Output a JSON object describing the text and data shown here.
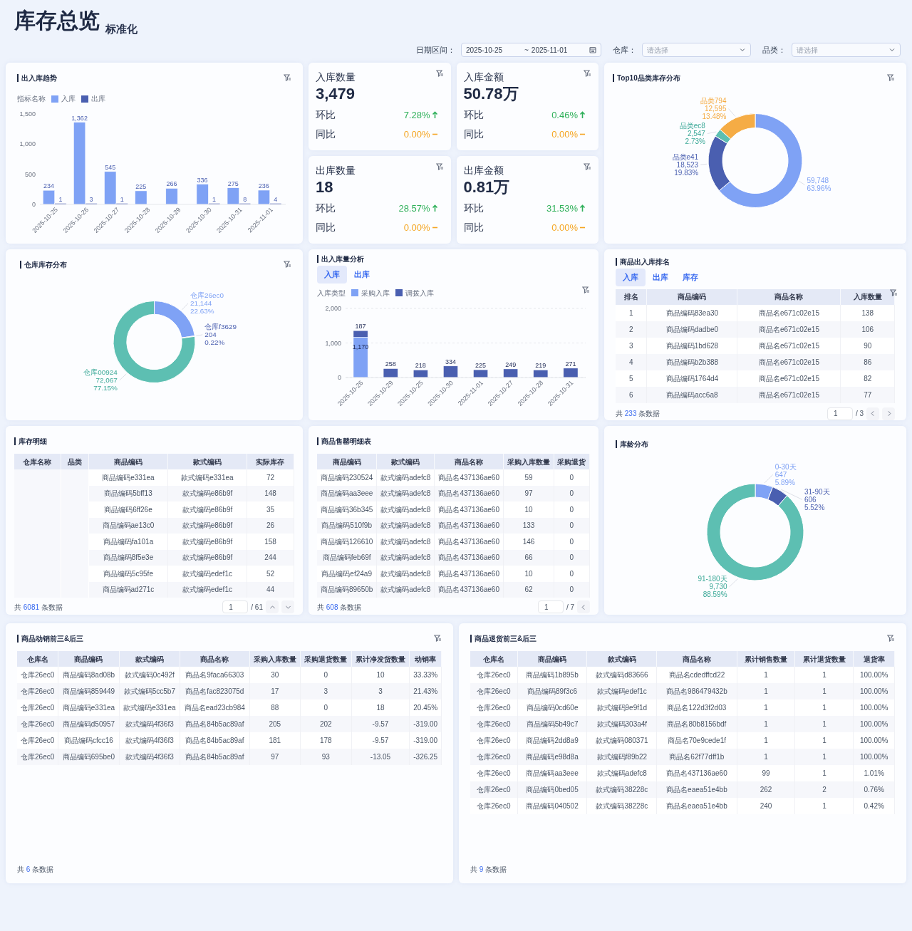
{
  "header": {
    "title": "库存总览",
    "subtitle": "标准化"
  },
  "filters": {
    "date": {
      "label": "日期区间：",
      "start": "2025-10-25",
      "separator": "~",
      "end": "2025-11-01"
    },
    "warehouse": {
      "label": "仓库：",
      "placeholder": "请选择"
    },
    "category": {
      "label": "品类：",
      "placeholder": "请选择"
    }
  },
  "trend": {
    "title": "出入库趋势",
    "legend_title": "指标名称",
    "chart_data": {
      "type": "bar",
      "categories": [
        "2025-10-25",
        "2025-10-26",
        "2025-10-27",
        "2025-10-28",
        "2025-10-29",
        "2025-10-30",
        "2025-10-31",
        "2025-11-01"
      ],
      "series": [
        {
          "name": "入库",
          "color": "#7fa2f5",
          "values": [
            234,
            1362,
            545,
            225,
            266,
            336,
            275,
            236
          ],
          "value_labels": [
            "234",
            "1,362",
            "545",
            "225",
            "266",
            "336",
            "275",
            "236"
          ]
        },
        {
          "name": "出库",
          "color": "#4a5fb0",
          "values": [
            1,
            3,
            1,
            null,
            null,
            1,
            8,
            4
          ],
          "value_labels": [
            "1",
            "3",
            "1",
            null,
            null,
            "1",
            "8",
            "4"
          ]
        }
      ],
      "ylim": [
        0,
        1500
      ],
      "yticks": [
        {
          "value": 0,
          "label": "0"
        },
        {
          "value": 500,
          "label": "500"
        },
        {
          "value": 1000,
          "label": "1,000"
        },
        {
          "value": 1500,
          "label": "1,500"
        }
      ],
      "stacked": false,
      "data_labels": true
    }
  },
  "kpis": [
    {
      "title": "入库数量",
      "value": "3,479",
      "rows": [
        {
          "label": "环比",
          "change": "7.28%",
          "kind": "up"
        },
        {
          "label": "同比",
          "change": "0.00%",
          "kind": "flat"
        }
      ]
    },
    {
      "title": "入库金额",
      "value": "50.78万",
      "rows": [
        {
          "label": "环比",
          "change": "0.46%",
          "kind": "up"
        },
        {
          "label": "同比",
          "change": "0.00%",
          "kind": "flat"
        }
      ]
    },
    {
      "title": "出库数量",
      "value": "18",
      "rows": [
        {
          "label": "环比",
          "change": "28.57%",
          "kind": "up"
        },
        {
          "label": "同比",
          "change": "0.00%",
          "kind": "flat"
        }
      ]
    },
    {
      "title": "出库金额",
      "value": "0.81万",
      "rows": [
        {
          "label": "环比",
          "change": "31.53%",
          "kind": "up"
        },
        {
          "label": "同比",
          "change": "0.00%",
          "kind": "flat"
        }
      ]
    }
  ],
  "top10": {
    "title": "Top10品类库存分布",
    "chart_data": {
      "type": "donut",
      "categories": [
        null,
        "品类e41",
        "品类ec8",
        "品类794"
      ],
      "values": [
        59748,
        18523,
        2547,
        12595
      ],
      "colors": [
        "#7fa2f5",
        "#4a5fb0",
        "#5dbfb2",
        "#f5ac45"
      ],
      "value_labels": [
        "59,748",
        "18,523",
        "2,547",
        "12,595"
      ],
      "annotations": [
        "63.96%",
        "19.83%",
        "2.73%",
        "13.48%"
      ]
    }
  },
  "warehouse_dist": {
    "title": "仓库库存分布",
    "chart_data": {
      "type": "donut",
      "categories": [
        "仓库26ec0",
        "仓库f3629",
        "仓库00924"
      ],
      "values": [
        21144,
        204,
        72067
      ],
      "colors": [
        "#7fa2f5",
        "#4a5fb0",
        "#5dbfb2"
      ],
      "value_labels": [
        "21,144",
        "204",
        "72,067"
      ],
      "annotations": [
        "22.63%",
        "0.22%",
        "77.15%"
      ]
    }
  },
  "flow": {
    "title": "出入库量分析",
    "tabs": [
      {
        "label": "入库",
        "selected": true
      },
      {
        "label": "出库",
        "selected": false
      }
    ],
    "legend_title": "入库类型",
    "chart_data": {
      "type": "bar",
      "categories": [
        "2025-10-26",
        "2025-10-29",
        "2025-10-25",
        "2025-10-30",
        "2025-11-01",
        "2025-10-27",
        "2025-10-28",
        "2025-10-31"
      ],
      "series": [
        {
          "name": "采购入库",
          "color": "#7fa2f5",
          "values": [
            1170,
            null,
            null,
            null,
            null,
            null,
            null,
            null
          ],
          "value_labels": [
            "1,170",
            null,
            null,
            null,
            null,
            null,
            null,
            null
          ]
        },
        {
          "name": "调拨入库",
          "color": "#4a5fb0",
          "values": [
            187,
            258,
            218,
            334,
            225,
            249,
            219,
            271
          ],
          "value_labels": [
            "187",
            "258",
            "218",
            "334",
            "225",
            "249",
            "219",
            "271"
          ]
        }
      ],
      "ylim": [
        0,
        2000
      ],
      "yticks": [
        {
          "value": 0,
          "label": "0"
        },
        {
          "value": 1000,
          "label": "1,000"
        },
        {
          "value": 2000,
          "label": "2,000"
        }
      ],
      "stacked": true,
      "data_labels": true
    }
  },
  "ranking": {
    "title": "商品出入库排名",
    "tabs": [
      {
        "label": "入库",
        "selected": true
      },
      {
        "label": "出库",
        "selected": false
      },
      {
        "label": "库存",
        "selected": false
      }
    ],
    "columns": [
      "排名",
      "商品编码",
      "商品名称",
      "入库数量"
    ],
    "rows": [
      [
        "1",
        "商品编码83ea30",
        "商品名e671c02e15",
        "138"
      ],
      [
        "2",
        "商品编码dadbe0",
        "商品名e671c02e15",
        "106"
      ],
      [
        "3",
        "商品编码1bd628",
        "商品名e671c02e15",
        "90"
      ],
      [
        "4",
        "商品编码b2b388",
        "商品名e671c02e15",
        "86"
      ],
      [
        "5",
        "商品编码1764d4",
        "商品名e671c02e15",
        "82"
      ],
      [
        "6",
        "商品编码acc6a8",
        "商品名e671c02e15",
        "77"
      ]
    ],
    "footer": {
      "prefix": "共",
      "count": "233",
      "suffix": "条数据"
    },
    "pager": {
      "page": "1",
      "total": "/ 3",
      "buttons": [
        {
          "kind": "left"
        },
        {
          "kind": "right"
        }
      ]
    }
  },
  "stock_detail": {
    "title": "库存明细",
    "columns": [
      "仓库名称",
      "品类",
      "商品编码",
      "款式编码",
      "实际库存"
    ],
    "rows": [
      [
        "",
        "",
        "商品编码e331ea",
        "款式编码e331ea",
        "72"
      ],
      [
        "",
        "",
        "商品编码5bff13",
        "款式编码e86b9f",
        "148"
      ],
      [
        "",
        "",
        "商品编码6ff26e",
        "款式编码e86b9f",
        "35"
      ],
      [
        "",
        "",
        "商品编码ae13c0",
        "款式编码e86b9f",
        "26"
      ],
      [
        "",
        "",
        "商品编码fa101a",
        "款式编码e86b9f",
        "158"
      ],
      [
        "",
        "",
        "商品编码8f5e3e",
        "款式编码e86b9f",
        "244"
      ],
      [
        "",
        "",
        "商品编码5c95fe",
        "款式编码edef1c",
        "52"
      ],
      [
        "",
        "",
        "商品编码ad271c",
        "款式编码edef1c",
        "44"
      ]
    ],
    "footer": {
      "prefix": "共",
      "count": "6081",
      "suffix": "条数据"
    },
    "pager": {
      "page": "1",
      "total": "/ 61",
      "buttons": [
        {
          "kind": "up"
        },
        {
          "kind": "down"
        }
      ]
    }
  },
  "sellout": {
    "title": "商品售罄明细表",
    "columns": [
      "商品编码",
      "款式编码",
      "商品名称",
      "采购入库数量",
      "采购退货"
    ],
    "rows": [
      [
        "商品编码230524",
        "款式编码adefc8",
        "商品名437136ae60",
        "59",
        "0"
      ],
      [
        "商品编码aa3eee",
        "款式编码adefc8",
        "商品名437136ae60",
        "97",
        "0"
      ],
      [
        "商品编码36b345",
        "款式编码adefc8",
        "商品名437136ae60",
        "10",
        "0"
      ],
      [
        "商品编码510f9b",
        "款式编码adefc8",
        "商品名437136ae60",
        "133",
        "0"
      ],
      [
        "商品编码126610",
        "款式编码adefc8",
        "商品名437136ae60",
        "146",
        "0"
      ],
      [
        "商品编码feb69f",
        "款式编码adefc8",
        "商品名437136ae60",
        "66",
        "0"
      ],
      [
        "商品编码ef24a9",
        "款式编码adefc8",
        "商品名437136ae60",
        "10",
        "0"
      ],
      [
        "商品编码89650b",
        "款式编码adefc8",
        "商品名437136ae60",
        "62",
        "0"
      ]
    ],
    "footer": {
      "prefix": "共",
      "count": "608",
      "suffix": "条数据"
    },
    "pager": {
      "page": "1",
      "total": "/ 7",
      "buttons": [
        {
          "kind": "left"
        }
      ]
    }
  },
  "age_dist": {
    "title": "库龄分布",
    "chart_data": {
      "type": "donut",
      "categories": [
        "0-30天",
        "31-90天",
        "91-180天"
      ],
      "values": [
        647,
        606,
        9730
      ],
      "colors": [
        "#7fa2f5",
        "#4a5fb0",
        "#5dbfb2"
      ],
      "value_labels": [
        "647",
        "606",
        "9,730"
      ],
      "annotations": [
        "5.89%",
        "5.52%",
        "88.59%"
      ]
    }
  },
  "movers": {
    "title": "商品动销前三&后三",
    "columns": [
      "仓库名",
      "商品编码",
      "款式编码",
      "商品名称",
      "采购入库数量",
      "采购退货数量",
      "累计净发货数量",
      "动销率"
    ],
    "rows": [
      [
        "仓库26ec0",
        "商品编码8ad08b",
        "款式编码0c492f",
        "商品名9faca66303",
        "30",
        "0",
        "10",
        "33.33%"
      ],
      [
        "仓库26ec0",
        "商品编码859449",
        "款式编码5cc5b7",
        "商品名fac823075d",
        "17",
        "3",
        "3",
        "21.43%"
      ],
      [
        "仓库26ec0",
        "商品编码e331ea",
        "款式编码e331ea",
        "商品名ead23cb984",
        "88",
        "0",
        "18",
        "20.45%"
      ],
      [
        "仓库26ec0",
        "商品编码d50957",
        "款式编码4f36f3",
        "商品名84b5ac89af",
        "205",
        "202",
        "-9.57",
        "-319.00"
      ],
      [
        "仓库26ec0",
        "商品编码cfcc16",
        "款式编码4f36f3",
        "商品名84b5ac89af",
        "181",
        "178",
        "-9.57",
        "-319.00"
      ],
      [
        "仓库26ec0",
        "商品编码695be0",
        "款式编码4f36f3",
        "商品名84b5ac89af",
        "97",
        "93",
        "-13.05",
        "-326.25"
      ]
    ],
    "footer": {
      "prefix": "共",
      "count": "6",
      "suffix": "条数据"
    }
  },
  "returns": {
    "title": "商品退货前三&后三",
    "columns": [
      "仓库名",
      "商品编码",
      "款式编码",
      "商品名称",
      "累计销售数量",
      "累计退货数量",
      "退货率"
    ],
    "rows": [
      [
        "仓库26ec0",
        "商品编码1b895b",
        "款式编码d83666",
        "商品名cdedffcd22",
        "1",
        "1",
        "100.00%"
      ],
      [
        "仓库26ec0",
        "商品编码89f3c6",
        "款式编码edef1c",
        "商品名986479432b",
        "1",
        "1",
        "100.00%"
      ],
      [
        "仓库26ec0",
        "商品编码0cd60e",
        "款式编码9e9f1d",
        "商品名122d3f2d03",
        "1",
        "1",
        "100.00%"
      ],
      [
        "仓库26ec0",
        "商品编码5b49c7",
        "款式编码303a4f",
        "商品名80b8156bdf",
        "1",
        "1",
        "100.00%"
      ],
      [
        "仓库26ec0",
        "商品编码2dd8a9",
        "款式编码080371",
        "商品名70e9cede1f",
        "1",
        "1",
        "100.00%"
      ],
      [
        "仓库26ec0",
        "商品编码e98d8a",
        "款式编码f89b22",
        "商品名62f77dff1b",
        "1",
        "1",
        "100.00%"
      ],
      [
        "仓库26ec0",
        "商品编码aa3eee",
        "款式编码adefc8",
        "商品名437136ae60",
        "99",
        "1",
        "1.01%"
      ],
      [
        "仓库26ec0",
        "商品编码0bed05",
        "款式编码38228c",
        "商品名eaea51e4bb",
        "262",
        "2",
        "0.76%"
      ],
      [
        "仓库26ec0",
        "商品编码040502",
        "款式编码38228c",
        "商品名eaea51e4bb",
        "240",
        "1",
        "0.42%"
      ]
    ],
    "footer": {
      "prefix": "共",
      "count": "9",
      "suffix": "条数据"
    }
  }
}
